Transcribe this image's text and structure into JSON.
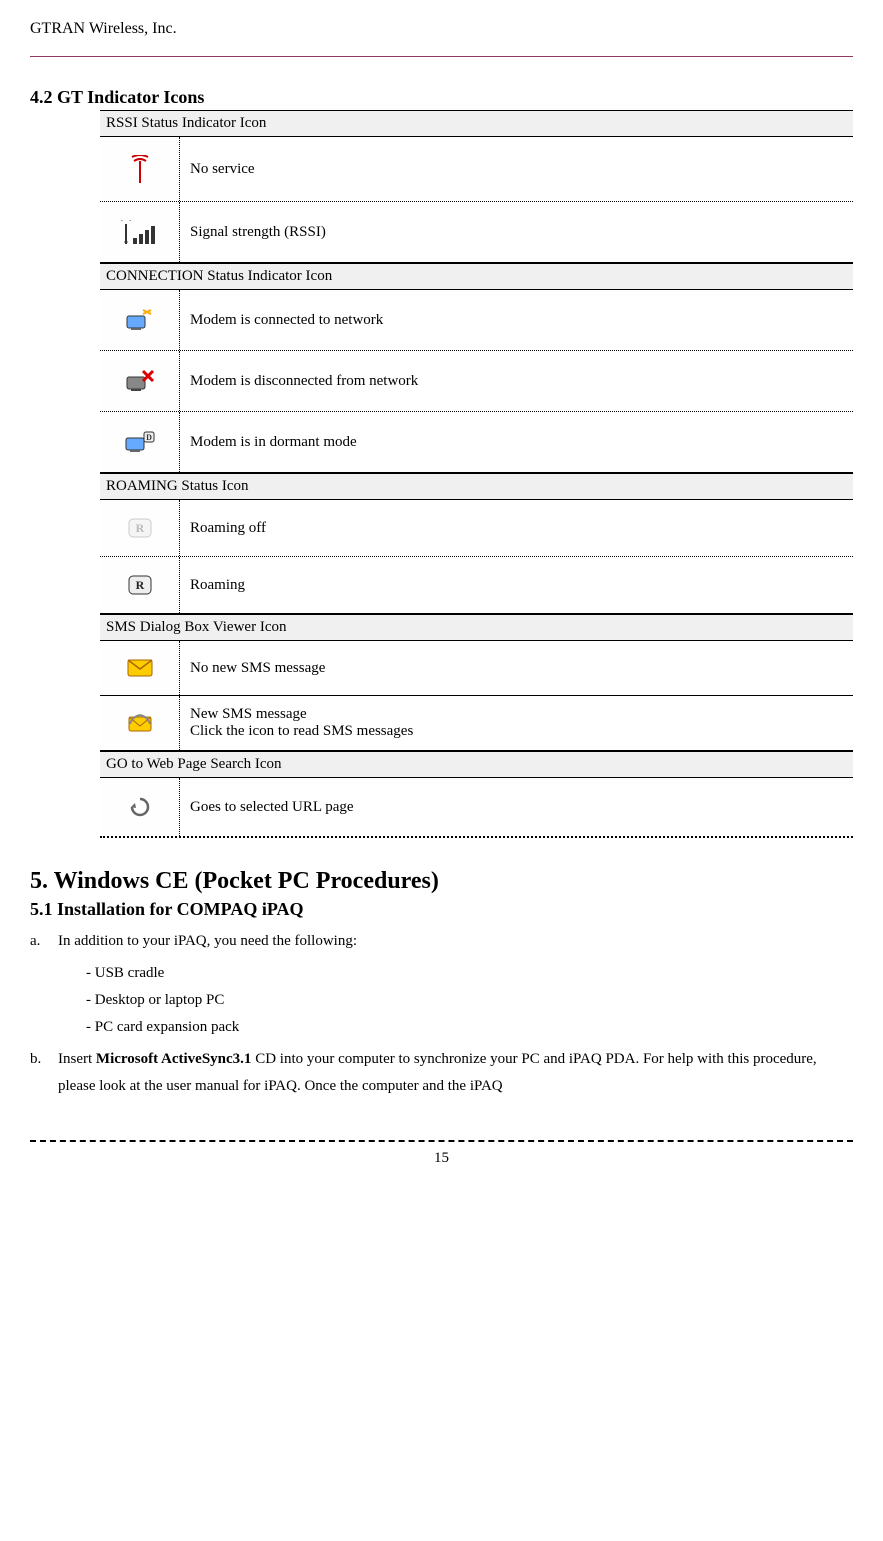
{
  "header": {
    "company": "GTRAN Wireless, Inc."
  },
  "section42": {
    "heading": "4.2 GT Indicator Icons",
    "groups": [
      {
        "title": "RSSI Status Indicator Icon",
        "rows": [
          {
            "icon": "antenna-red",
            "desc": "No service"
          },
          {
            "icon": "signal-bars",
            "desc": "Signal strength (RSSI)"
          }
        ]
      },
      {
        "title": "CONNECTION Status Indicator Icon",
        "rows": [
          {
            "icon": "modem-connected",
            "desc": "Modem is connected to network"
          },
          {
            "icon": "modem-disconnected",
            "desc": "Modem is disconnected from network"
          },
          {
            "icon": "modem-dormant",
            "desc": "Modem is in dormant mode"
          }
        ]
      },
      {
        "title": "ROAMING Status Icon",
        "rows": [
          {
            "icon": "roaming-off",
            "desc": "Roaming off"
          },
          {
            "icon": "roaming-on",
            "desc": "Roaming"
          }
        ]
      },
      {
        "title": "SMS Dialog Box Viewer Icon",
        "rows": [
          {
            "icon": "sms-none",
            "desc": "No new SMS message"
          },
          {
            "icon": "sms-new",
            "desc": "New SMS message",
            "desc2": "Click the icon to read SMS messages"
          }
        ]
      },
      {
        "title": "GO to Web Page Search Icon",
        "rows": [
          {
            "icon": "go-web",
            "desc": "Goes to selected URL page"
          }
        ]
      }
    ]
  },
  "section5": {
    "heading": "5. Windows CE (Pocket PC Procedures)",
    "sub51": "5.1 Installation for COMPAQ iPAQ",
    "item_a": {
      "marker": "a.",
      "text": "In addition to your iPAQ, you need the following:",
      "subs": [
        "- USB cradle",
        "- Desktop or laptop PC",
        "- PC card expansion pack"
      ]
    },
    "item_b": {
      "marker": "b.",
      "prefix": "Insert ",
      "bold": "Microsoft ActiveSync3.1",
      "suffix": " CD into your computer to synchronize your PC and iPAQ PDA. For help with this procedure, please look at the user manual for iPAQ. Once the computer and the iPAQ"
    }
  },
  "footer": {
    "page": "15"
  }
}
